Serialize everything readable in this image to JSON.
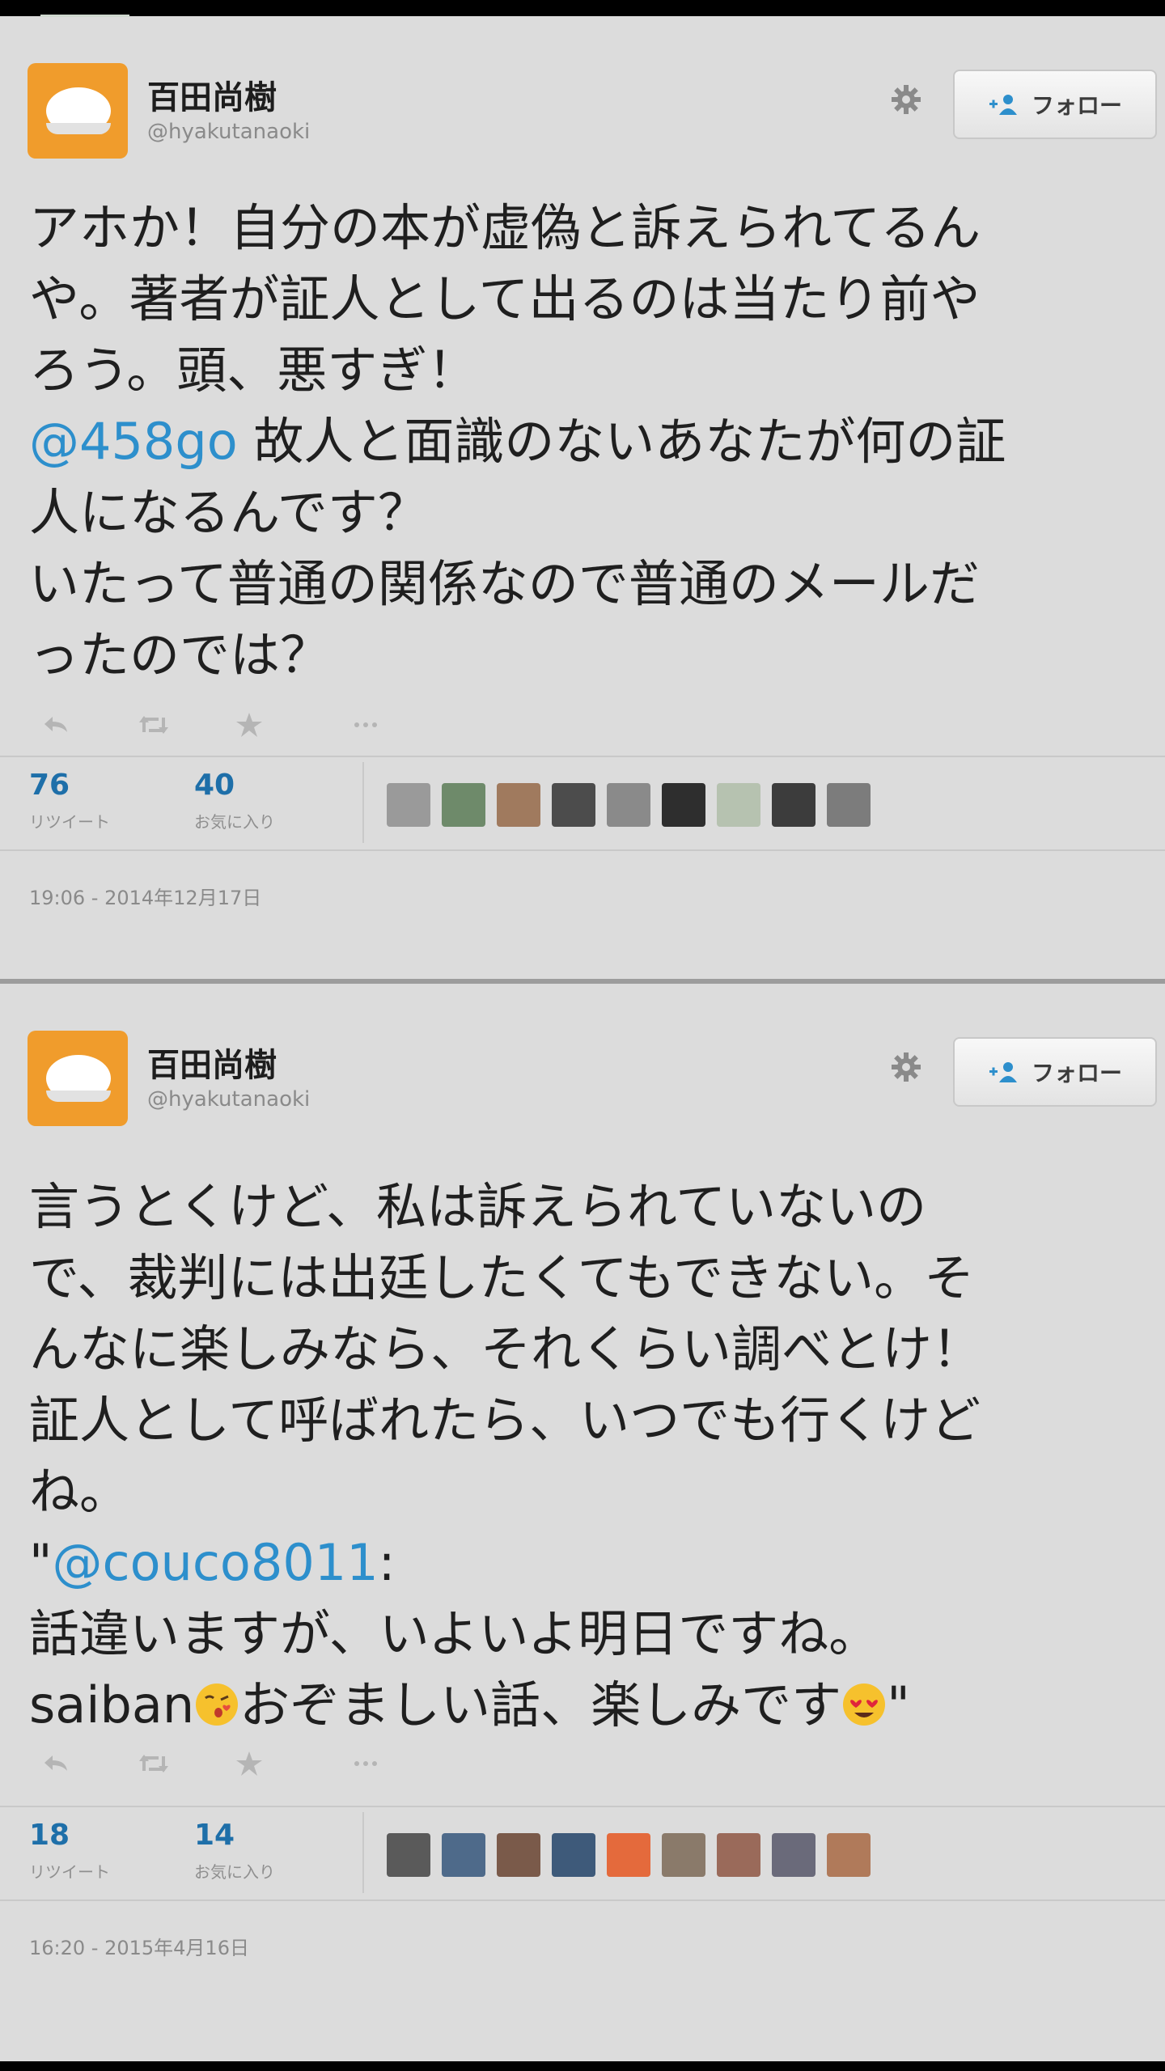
{
  "tweets": [
    {
      "user": {
        "name": "百田尚樹",
        "handle": "@hyakutanaoki"
      },
      "follow_label": "フォロー",
      "lines": [
        [
          {
            "t": "アホか！自分の本が虚偽と訴えられてるん"
          }
        ],
        [
          {
            "t": "や。著者が証人として出るのは当たり前や"
          }
        ],
        [
          {
            "t": "ろう。頭、悪すぎ！"
          }
        ],
        [
          {
            "t": "@458go",
            "mention": true
          },
          {
            "t": " 故人と面識のないあなたが何の証"
          }
        ],
        [
          {
            "t": "人になるんです？"
          }
        ],
        [
          {
            "t": "いたって普通の関係なので普通のメールだ"
          }
        ],
        [
          {
            "t": "ったのでは？"
          }
        ]
      ],
      "retweets": "76",
      "retweet_label": "リツイート",
      "favorites": "40",
      "favorite_label": "お気に入り",
      "faces": [
        "#9a9a9a",
        "#6e8a6a",
        "#a07a5e",
        "#4c4c4c",
        "#8a8a8a",
        "#2e2e2e",
        "#b6c2b0",
        "#3c3c3c",
        "#7c7c7c"
      ],
      "timestamp": "19:06 - 2014年12月17日"
    },
    {
      "user": {
        "name": "百田尚樹",
        "handle": "@hyakutanaoki"
      },
      "follow_label": "フォロー",
      "lines": [
        [
          {
            "t": "言うとくけど、私は訴えられていないの"
          }
        ],
        [
          {
            "t": "で、裁判には出廷したくてもできない。そ"
          }
        ],
        [
          {
            "t": "んなに楽しみなら、それくらい調べとけ！"
          }
        ],
        [
          {
            "t": "証人として呼ばれたら、いつでも行くけど"
          }
        ],
        [
          {
            "t": "ね。"
          }
        ],
        [
          {
            "t": "\""
          },
          {
            "t": "@couco8011",
            "mention": true
          },
          {
            "t": ":"
          }
        ],
        [
          {
            "t": "話違いますが、いよいよ明日ですね。"
          }
        ],
        [
          {
            "t": "saiban"
          },
          {
            "emoji": "kiss-face"
          },
          {
            "t": "おぞましい話、楽しみです"
          },
          {
            "emoji": "heart-eyes-face"
          },
          {
            "t": "\""
          }
        ]
      ],
      "retweets": "18",
      "retweet_label": "リツイート",
      "favorites": "14",
      "favorite_label": "お気に入り",
      "faces": [
        "#5a5a5a",
        "#4e6a8a",
        "#7a5a4a",
        "#3e5a7a",
        "#e46a3c",
        "#8a7a6a",
        "#9a6a5a",
        "#6a6a7a",
        "#b07a5a"
      ],
      "timestamp": "16:20 - 2015年4月16日"
    }
  ],
  "icons": {
    "gear": "gear-icon",
    "follow": "add-user-icon",
    "reply": "reply-icon",
    "retweet": "retweet-icon",
    "favorite": "star-icon",
    "more": "more-icon"
  },
  "colors": {
    "background": "#dcdcdc",
    "mention": "#2d8fcc",
    "avatar": "#f09c2c",
    "stat_number": "#1e6fa9"
  }
}
